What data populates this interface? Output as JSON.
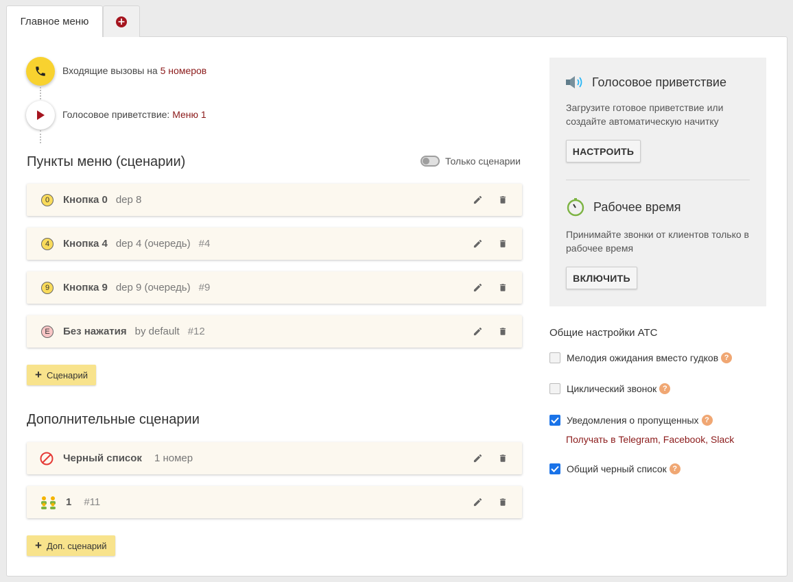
{
  "tabs": {
    "main_label": "Главное меню"
  },
  "flow": {
    "incoming_prefix": "Входящие вызовы на",
    "incoming_link": "5 номеров",
    "greeting_prefix": "Голосовое приветствие:",
    "greeting_link": "Меню 1"
  },
  "menu_section": {
    "title": "Пункты меню (сценарии)",
    "toggle_label": "Только сценарии",
    "items": [
      {
        "badge": "0",
        "badge_color": "#f9db5b",
        "title": "Кнопка 0",
        "sub": "dep 8",
        "num": ""
      },
      {
        "badge": "4",
        "badge_color": "#f9db5b",
        "title": "Кнопка 4",
        "sub": "dep 4 (очередь)",
        "num": "#4"
      },
      {
        "badge": "9",
        "badge_color": "#f9db5b",
        "title": "Кнопка 9",
        "sub": "dep 9 (очередь)",
        "num": "#9"
      },
      {
        "badge": "E",
        "badge_color": "#f8c5c5",
        "title": "Без нажатия",
        "sub": "by default",
        "num": "#12"
      }
    ],
    "add_label": "Сценарий"
  },
  "extra_section": {
    "title": "Дополнительные сценарии",
    "items": [
      {
        "icon": "blacklist-icon",
        "title": "Черный список",
        "sub": "1 номер"
      },
      {
        "icon": "group-icon",
        "title": "1",
        "sub": "#11"
      }
    ],
    "add_label": "Доп. сценарий"
  },
  "side": {
    "greeting_title": "Голосовое приветствие",
    "greeting_desc": "Загрузите готовое приветствие или создайте автоматическую начитку",
    "greeting_btn": "НАСТРОИТЬ",
    "worktime_title": "Рабочее время",
    "worktime_desc": "Принимайте звонки от клиентов только в рабочее время",
    "worktime_btn": "ВКЛЮЧИТЬ"
  },
  "settings": {
    "title": "Общие настройки АТС",
    "options": [
      {
        "label": "Мелодия ожидания вместо гудков",
        "checked": false
      },
      {
        "label": "Циклический звонок",
        "checked": false
      },
      {
        "label": "Уведомления о пропущенных",
        "checked": true
      },
      {
        "label": "Общий черный список",
        "checked": true
      }
    ],
    "notify_link": "Получать в Telegram, Facebook, Slack"
  },
  "colors": {
    "accent": "#a5151f",
    "link": "#8b1a1a",
    "yellow": "#f8d22f",
    "checkbox": "#1a73e8"
  }
}
